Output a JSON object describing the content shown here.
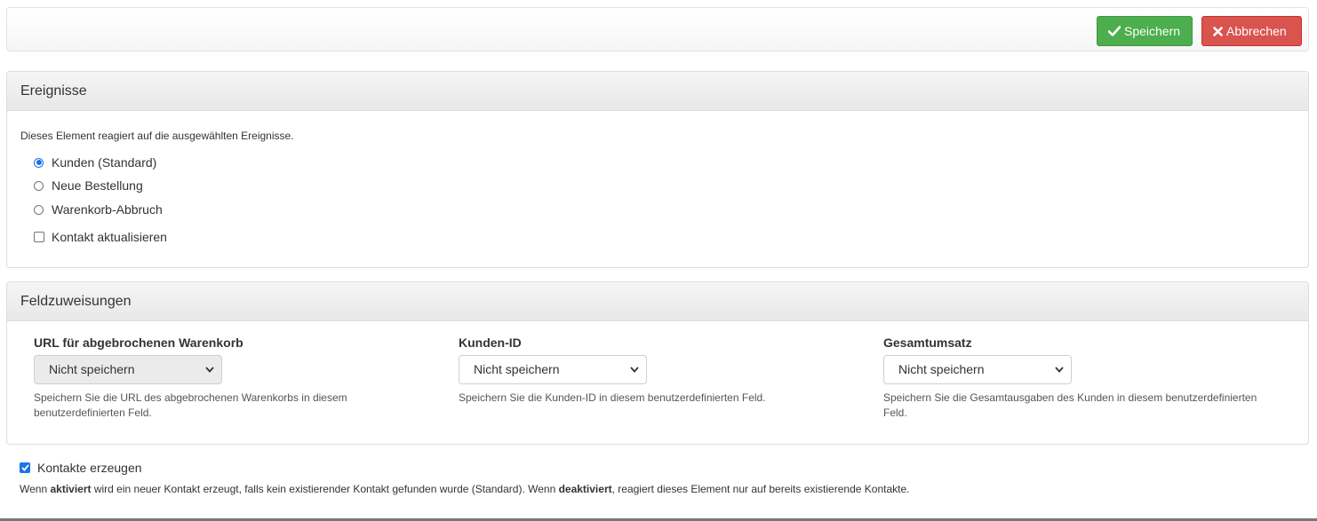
{
  "toolbar": {
    "save_label": "Speichern",
    "cancel_label": "Abbrechen"
  },
  "events_panel": {
    "title": "Ereignisse",
    "description": "Dieses Element reagiert auf die ausgewählten Ereignisse.",
    "options": [
      {
        "label": "Kunden (Standard)",
        "selected": true
      },
      {
        "label": "Neue Bestellung",
        "selected": false
      },
      {
        "label": "Warenkorb-Abbruch",
        "selected": false
      }
    ],
    "update_contact": {
      "label": "Kontakt aktualisieren",
      "checked": false
    }
  },
  "fields_panel": {
    "title": "Feldzuweisungen",
    "fields": [
      {
        "label": "URL für abgebrochenen Warenkorb",
        "value": "Nicht speichern",
        "disabled": true,
        "help": "Speichern Sie die URL des abgebrochenen Warenkorbs in diesem benutzerdefinierten Feld."
      },
      {
        "label": "Kunden-ID",
        "value": "Nicht speichern",
        "disabled": false,
        "help": "Speichern Sie die Kunden-ID in diesem benutzerdefinierten Feld."
      },
      {
        "label": "Gesamtumsatz",
        "value": "Nicht speichern",
        "disabled": false,
        "help": "Speichern Sie die Gesamtausgaben des Kunden in diesem benutzerdefinierten Feld."
      }
    ]
  },
  "create_contacts": {
    "label": "Kontakte erzeugen",
    "checked": true,
    "help_prefix": "Wenn ",
    "help_bold1": "aktiviert",
    "help_mid": " wird ein neuer Kontakt erzeugt, falls kein existierender Kontakt gefunden wurde (Standard). Wenn ",
    "help_bold2": "deaktiviert",
    "help_suffix": ", reagiert dieses Element nur auf bereits existierende Kontakte."
  },
  "colors": {
    "save": "#4cae4c",
    "cancel": "#d9534f",
    "accent": "#1a73e8"
  }
}
